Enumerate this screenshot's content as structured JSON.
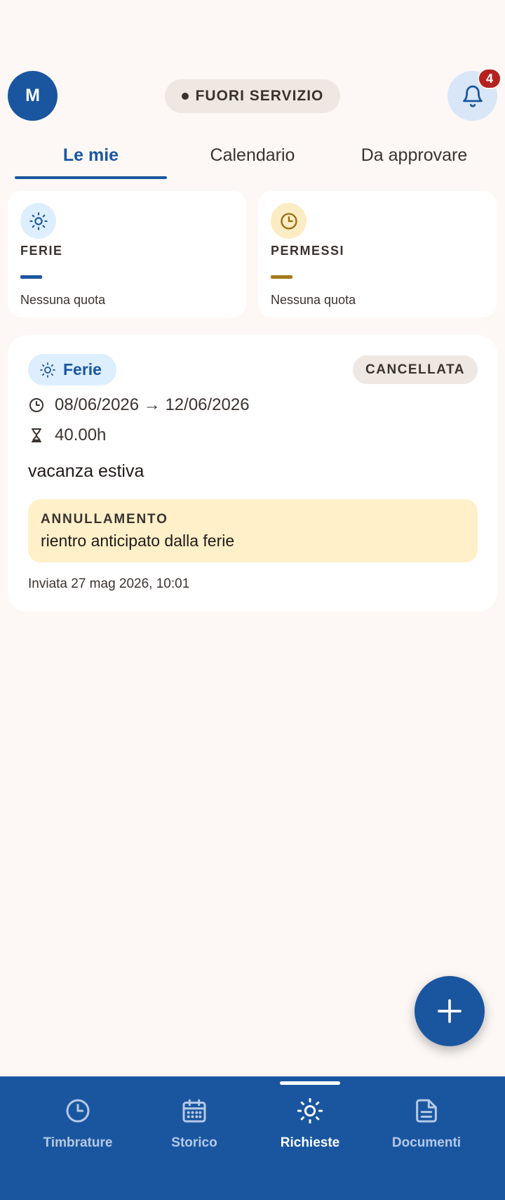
{
  "header": {
    "avatar_initial": "M",
    "status_label": "FUORI SERVIZIO",
    "notification_count": "4"
  },
  "tabs": [
    {
      "label": "Le mie",
      "active": true
    },
    {
      "label": "Calendario",
      "active": false
    },
    {
      "label": "Da approvare",
      "active": false
    }
  ],
  "quotas": [
    {
      "title": "FERIE",
      "note": "Nessuna quota",
      "icon": "sun-icon",
      "color": "#1a56a0"
    },
    {
      "title": "PERMESSI",
      "note": "Nessuna quota",
      "icon": "clock-icon",
      "color": "#a77a1a"
    }
  ],
  "request": {
    "type_label": "Ferie",
    "state_label": "CANCELLATA",
    "dates": "08/06/2026 → 12/06/2026",
    "hours": "40.00h",
    "reason": "vacanza estiva",
    "cancellation_label": "ANNULLAMENTO",
    "cancellation_text": "rientro anticipato dalla ferie",
    "sent": "Inviata 27 mag 2026, 10:01"
  },
  "bottom_nav": [
    {
      "label": "Timbrature",
      "icon": "clock-icon",
      "active": false
    },
    {
      "label": "Storico",
      "icon": "calendar-icon",
      "active": false
    },
    {
      "label": "Richieste",
      "icon": "sun-icon",
      "active": true
    },
    {
      "label": "Documenti",
      "icon": "document-icon",
      "active": false
    }
  ],
  "colors": {
    "primary": "#1a56a0",
    "background": "#fdf8f5",
    "badge": "#b3221f",
    "cancellation_bg": "#fff0c9"
  }
}
